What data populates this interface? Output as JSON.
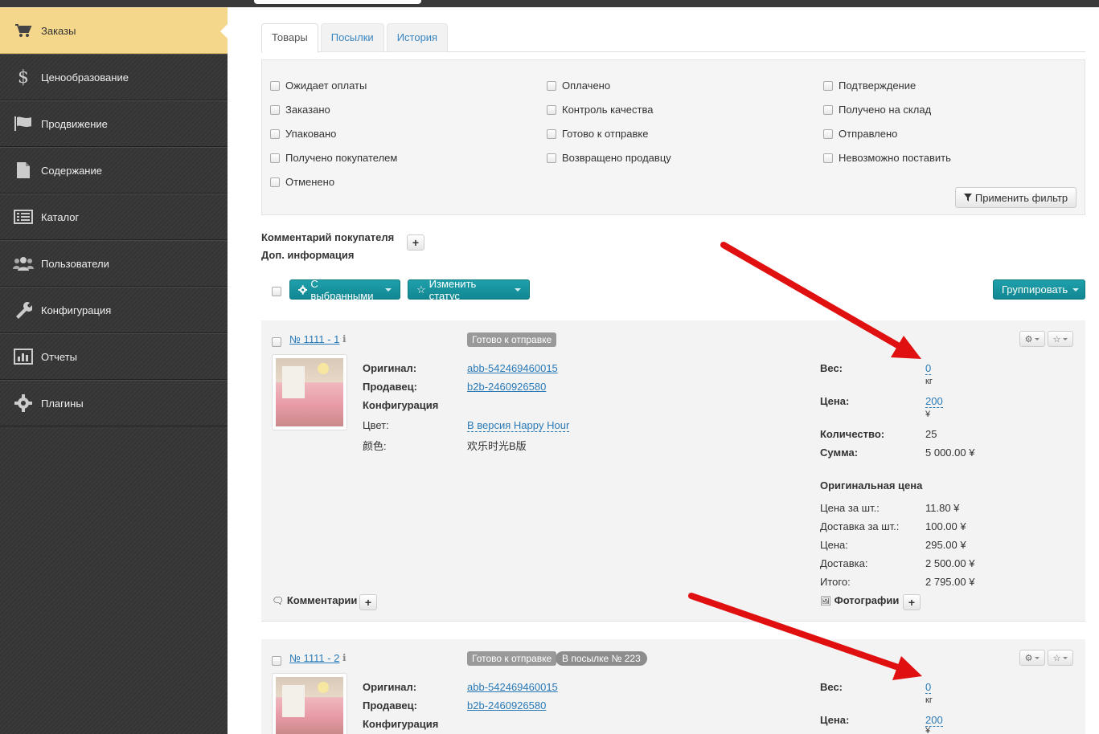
{
  "sidebar": {
    "items": [
      {
        "label": "Заказы",
        "icon": "cart-icon",
        "active": true
      },
      {
        "label": "Ценообразование",
        "icon": "dollar-icon"
      },
      {
        "label": "Продвижение",
        "icon": "flag-icon"
      },
      {
        "label": "Содержание",
        "icon": "document-icon"
      },
      {
        "label": "Каталог",
        "icon": "list-icon"
      },
      {
        "label": "Пользователи",
        "icon": "users-icon"
      },
      {
        "label": "Конфигурация",
        "icon": "wrench-icon"
      },
      {
        "label": "Отчеты",
        "icon": "bar-chart-icon"
      },
      {
        "label": "Плагины",
        "icon": "gear-icon"
      }
    ]
  },
  "tabs": [
    "Товары",
    "Посылки",
    "История"
  ],
  "filters": {
    "col1": [
      "Ожидает оплаты",
      "Заказано",
      "Упаковано",
      "Получено покупателем",
      "Отменено"
    ],
    "col2": [
      "Оплачено",
      "Контроль качества",
      "Готово к отправке",
      "Возвращено продавцу"
    ],
    "col3": [
      "Подтверждение",
      "Получено на склад",
      "Отправлено",
      "Невозможно поставить"
    ],
    "apply_label": "Применить фильтр"
  },
  "customer_comment_label": "Комментарий покупателя",
  "extra_info_label": "Доп. информация",
  "plus": "+",
  "actions": {
    "selected_label": "С выбранными",
    "change_status_label": "Изменить статус",
    "group_label": "Группировать"
  },
  "orders": [
    {
      "number": "№ 1111 - 1",
      "status": "Готово к отправке",
      "parcel": "",
      "original_label": "Оригинал:",
      "original_value": "abb-542469460015",
      "seller_label": "Продавец:",
      "seller_value": "b2b-2460926580",
      "config_label": "Конфигурация",
      "color_label": "Цвет:",
      "color_value": "B версия Happy Hour",
      "cn_label": "颜色:",
      "cn_value": "欢乐时光B版",
      "weight_label": "Вес:",
      "weight_value": "0",
      "weight_unit": "кг",
      "price_label": "Цена:",
      "price_value": "200",
      "currency": "¥",
      "qty_label": "Количество:",
      "qty_value": "25",
      "sum_label": "Сумма:",
      "sum_value": "5 000.00 ¥",
      "orig_price_title": "Оригинальная цена",
      "orig_rows": [
        {
          "label": "Цена за шт.:",
          "value": "11.80 ¥"
        },
        {
          "label": "Доставка за шт.:",
          "value": "100.00 ¥"
        },
        {
          "label": "Цена:",
          "value": "295.00 ¥"
        },
        {
          "label": "Доставка:",
          "value": "2 500.00 ¥"
        },
        {
          "label": "Итого:",
          "value": "2 795.00 ¥"
        }
      ],
      "comments_label": "Комментарии",
      "photos_label": "Фотографии"
    },
    {
      "number": "№ 1111 - 2",
      "status": "Готово к отправке",
      "parcel": "В посылке № 223",
      "original_label": "Оригинал:",
      "original_value": "abb-542469460015",
      "seller_label": "Продавец:",
      "seller_value": "b2b-2460926580",
      "config_label": "Конфигурация",
      "weight_label": "Вес:",
      "weight_value": "0",
      "weight_unit": "кг",
      "price_label": "Цена:",
      "price_value": "200",
      "currency": "¥"
    }
  ],
  "colors": {
    "active_sidebar": "#f5d78c",
    "teal_button": "#138a95",
    "link": "#2a7ab8",
    "arrow": "#e01010"
  }
}
